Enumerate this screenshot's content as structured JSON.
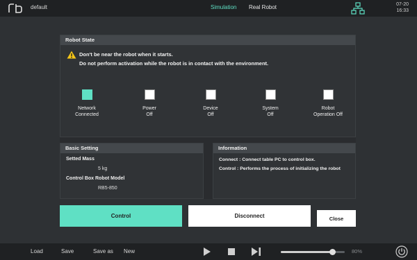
{
  "topbar": {
    "project": "default",
    "tabs": [
      {
        "label": "Simulation",
        "active": true
      },
      {
        "label": "Real Robot",
        "active": false
      }
    ],
    "date": "07-20",
    "time": "16:33"
  },
  "robot_state": {
    "title": "Robot State",
    "warning_line1": "Don't be near the robot when it starts.",
    "warning_line2": "Do not perform activation while the robot is in contact with the environment.",
    "statuses": [
      {
        "line1": "Network",
        "line2": "Connected",
        "on": true
      },
      {
        "line1": "Power",
        "line2": "Off",
        "on": false
      },
      {
        "line1": "Device",
        "line2": "Off",
        "on": false
      },
      {
        "line1": "System",
        "line2": "Off",
        "on": false
      },
      {
        "line1": "Robot",
        "line2": "Operation Off",
        "on": false
      }
    ]
  },
  "basic_setting": {
    "title": "Basic Setting",
    "mass_label": "Setted Mass",
    "mass_value": "5 kg",
    "model_label": "Control Box Robot Model",
    "model_value": "RB5-850"
  },
  "information": {
    "title": "Information",
    "line1": "Connect : Connect table PC to control box.",
    "line2": "Control : Performs the process of initializing the robot"
  },
  "buttons": {
    "control": "Control",
    "disconnect": "Disconnect",
    "close": "Close"
  },
  "bottombar": {
    "load": "Load",
    "save": "Save",
    "save_as": "Save as",
    "new": "New",
    "speed_value": 0.8,
    "speed_text": "80%"
  },
  "colors": {
    "accent": "#5fe0c4",
    "background": "#2e3134",
    "bar": "#1f2123"
  },
  "icons": {
    "logo": "rb-logo",
    "network": "network-icon",
    "warning": "warning-icon",
    "play": "play-icon",
    "stop": "stop-icon",
    "skip": "skip-next-icon",
    "power": "power-icon"
  }
}
